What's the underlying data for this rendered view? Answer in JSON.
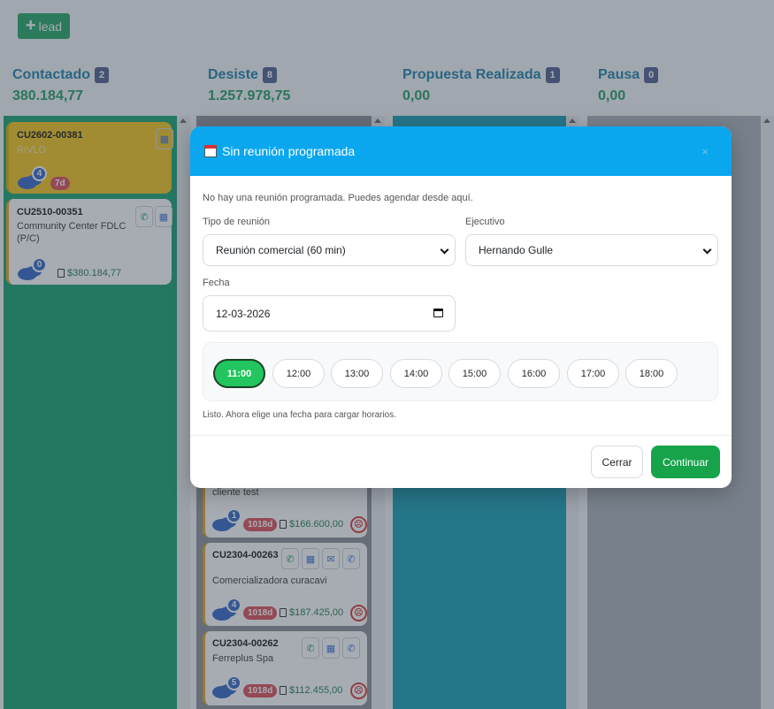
{
  "toolbar": {
    "add_lead_plus": "+",
    "add_lead_label": "lead"
  },
  "columns": [
    {
      "title": "Contactado",
      "count": "2",
      "total": "380.184,77",
      "color": "#12a06d"
    },
    {
      "title": "Desiste",
      "count": "8",
      "total": "1.257.978,75",
      "color": "#8a8f98"
    },
    {
      "title": "Propuesta Realizada",
      "count": "1",
      "total": "0,00",
      "color": "#139db5"
    },
    {
      "title": "Pausa",
      "count": "0",
      "total": "0,00",
      "color": "#aab0b8"
    }
  ],
  "cards": {
    "c1": {
      "code": "CU2602-00381",
      "name": "RIVLO",
      "messages": "4",
      "age": "7d",
      "bg": "#f5c518"
    },
    "c2": {
      "code": "CU2510-00351",
      "name": "Community Center FDLC (P/C)",
      "messages": "0",
      "amount": "$380.184,77"
    },
    "d1": {
      "name": "cliente test",
      "messages": "1",
      "age": "1018d",
      "amount": "$166.600,00"
    },
    "d2": {
      "code": "CU2304-00263",
      "name": "Comercializadora curacavi",
      "messages": "4",
      "age": "1018d",
      "amount": "$187.425,00"
    },
    "d3": {
      "code": "CU2304-00262",
      "name": "Ferreplus Spa",
      "messages": "5",
      "age": "1018d",
      "amount": "$112.455,00"
    }
  },
  "modal": {
    "title": "Sin reunión programada",
    "close_label": "×",
    "note": "No hay una reunión programada. Puedes agendar desde aquí.",
    "meeting_type_label": "Tipo de reunión",
    "meeting_type_value": "Reunión comercial (60 min)",
    "executive_label": "Ejecutivo",
    "executive_value": "Hernando Gulle",
    "date_label": "Fecha",
    "date_value": "12-03-2026",
    "slots": [
      "11:00",
      "12:00",
      "13:00",
      "14:00",
      "15:00",
      "16:00",
      "17:00",
      "18:00"
    ],
    "selected_slot": "11:00",
    "status": "Listo. Ahora elige una fecha para cargar horarios.",
    "cancel_label": "Cerrar",
    "continue_label": "Continuar"
  }
}
